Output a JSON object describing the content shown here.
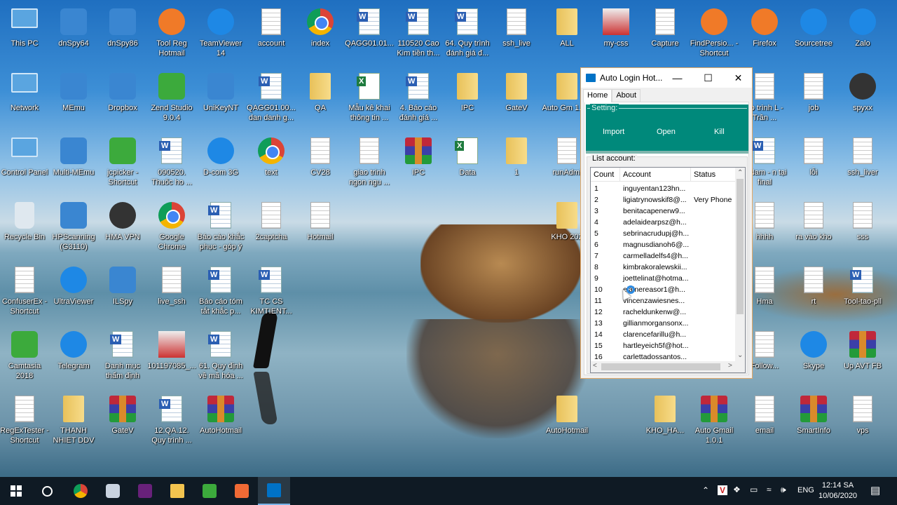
{
  "desktop": {
    "columns": [
      [
        {
          "label": "This PC",
          "icon": "pc"
        },
        {
          "label": "Network",
          "icon": "pc"
        },
        {
          "label": "Control Panel",
          "icon": "pc"
        },
        {
          "label": "Recycle Bin",
          "icon": "bin"
        },
        {
          "label": "ConfuserEx - Shortcut",
          "icon": "doc"
        },
        {
          "label": "Camtasia 2018",
          "icon": "green"
        },
        {
          "label": "RegExTester - Shortcut",
          "icon": "doc"
        }
      ],
      [
        {
          "label": "dnSpy64",
          "icon": "app"
        },
        {
          "label": "MEmu",
          "icon": "app"
        },
        {
          "label": "Multi-MEmu",
          "icon": "app"
        },
        {
          "label": "HPScanning (G3110)",
          "icon": "app"
        },
        {
          "label": "UltraViewer",
          "icon": "round"
        },
        {
          "label": "Telegram",
          "icon": "round"
        },
        {
          "label": "THANH NHIET DDV",
          "icon": "folder"
        }
      ],
      [
        {
          "label": "dnSpy86",
          "icon": "app"
        },
        {
          "label": "Dropbox",
          "icon": "app"
        },
        {
          "label": "jcpicker - Shortcut",
          "icon": "green"
        },
        {
          "label": "HMA VPN",
          "icon": "dark"
        },
        {
          "label": "ILSpy",
          "icon": "app"
        },
        {
          "label": "Danh mục thẩm định",
          "icon": "word"
        },
        {
          "label": "GateV",
          "icon": "winrar"
        }
      ],
      [
        {
          "label": "Tool Reg Hotmail",
          "icon": "orange"
        },
        {
          "label": "Zend Studio 9.0.4",
          "icon": "green"
        },
        {
          "label": "090520. Thuốc ho ...",
          "icon": "word"
        },
        {
          "label": "Google Chrome",
          "icon": "chrome"
        },
        {
          "label": "live_ssh",
          "icon": "doc"
        },
        {
          "label": "101197085_...",
          "icon": "pic"
        },
        {
          "label": "12.QA.12. Quy trình ...",
          "icon": "word"
        }
      ],
      [
        {
          "label": "TeamViewer 14",
          "icon": "round"
        },
        {
          "label": "UniKeyNT",
          "icon": "app"
        },
        {
          "label": "D-com 3G",
          "icon": "round"
        },
        {
          "label": "Báo cáo khắc phục - góp ý",
          "icon": "word"
        },
        {
          "label": "Báo cáo tóm tắt khắc p...",
          "icon": "word"
        },
        {
          "label": "61. Quy định về mã hóa ...",
          "icon": "word"
        },
        {
          "label": "AutoHotmail",
          "icon": "winrar"
        }
      ],
      [
        {
          "label": "account",
          "icon": "doc"
        },
        {
          "label": "QAGG01.00... dan danh g...",
          "icon": "word"
        },
        {
          "label": "text",
          "icon": "chrome"
        },
        {
          "label": "2captcha",
          "icon": "doc"
        },
        {
          "label": "TC CS KIMTIENT...",
          "icon": "word"
        },
        null,
        null
      ],
      [
        {
          "label": "index",
          "icon": "chrome"
        },
        {
          "label": "QA",
          "icon": "folder"
        },
        {
          "label": "CV28",
          "icon": "doc"
        },
        {
          "label": "Hotmail",
          "icon": "doc"
        },
        null,
        null,
        null
      ],
      [
        {
          "label": "QAGG01.01...",
          "icon": "word"
        },
        {
          "label": "Mẫu kê khai thông tin ...",
          "icon": "excel"
        },
        {
          "label": "giao trinh ngon ngu ...",
          "icon": "doc"
        },
        null,
        null,
        null,
        null
      ],
      [
        {
          "label": "110520 Cao Kim tiền th...",
          "icon": "word"
        },
        {
          "label": "4. Báo cáo đánh giá ...",
          "icon": "word"
        },
        {
          "label": "IPC",
          "icon": "winrar"
        },
        null,
        null,
        null,
        null
      ],
      [
        {
          "label": "64. Quy trình đánh giá đ...",
          "icon": "word"
        },
        {
          "label": "IPC",
          "icon": "folder"
        },
        {
          "label": "Data",
          "icon": "excel"
        },
        null,
        null,
        null,
        null
      ],
      [
        {
          "label": "ssh_live",
          "icon": "doc"
        },
        {
          "label": "GateV",
          "icon": "folder"
        },
        {
          "label": "1",
          "icon": "folder"
        },
        null,
        null,
        null,
        null
      ],
      [
        {
          "label": "ALL",
          "icon": "folder"
        },
        {
          "label": "Auto Gm 1.0.1",
          "icon": "folder"
        },
        {
          "label": "runAdmi",
          "icon": "doc"
        },
        {
          "label": "KHO 202",
          "icon": "folder"
        },
        null,
        null,
        {
          "label": "AutoHotmail",
          "icon": "folder"
        }
      ],
      [
        {
          "label": "my-css",
          "icon": "pic"
        },
        null,
        null,
        null,
        null,
        null,
        null
      ],
      [
        {
          "label": "Capture",
          "icon": "doc"
        },
        null,
        null,
        null,
        null,
        null,
        {
          "label": "KHO_HA...",
          "icon": "folder"
        }
      ],
      [
        {
          "label": "FindPersio... - Shortcut",
          "icon": "orange"
        },
        null,
        null,
        null,
        null,
        null,
        {
          "label": "Auto Gmail 1.0.1",
          "icon": "winrar"
        }
      ],
      [
        {
          "label": "Firefox",
          "icon": "orange"
        },
        {
          "label": "áo trình L - Trần ...",
          "icon": "doc"
        },
        {
          "label": "à Nam - n tại final",
          "icon": "word"
        },
        {
          "label": "hhhh",
          "icon": "doc"
        },
        {
          "label": "Hma",
          "icon": "doc"
        },
        {
          "label": "Follow...",
          "icon": "doc"
        },
        {
          "label": "email",
          "icon": "doc"
        }
      ],
      [
        {
          "label": "Sourcetree",
          "icon": "round"
        },
        {
          "label": "job",
          "icon": "doc"
        },
        {
          "label": "lỗi",
          "icon": "doc"
        },
        {
          "label": "ra vào kho",
          "icon": "doc"
        },
        {
          "label": "rt",
          "icon": "doc"
        },
        {
          "label": "Skype",
          "icon": "round"
        },
        {
          "label": "SmartInfo",
          "icon": "winrar"
        }
      ],
      [
        {
          "label": "Zalo",
          "icon": "round"
        },
        {
          "label": "spyxx",
          "icon": "dark"
        },
        {
          "label": "ssh_liver",
          "icon": "doc"
        },
        {
          "label": "sss",
          "icon": "doc"
        },
        {
          "label": "Tool-tao-pll",
          "icon": "word"
        },
        {
          "label": "Up AVT FB",
          "icon": "winrar"
        },
        {
          "label": "vps",
          "icon": "doc"
        }
      ]
    ]
  },
  "window": {
    "title": "Auto Login Hot...",
    "tabs": [
      "Home",
      "About"
    ],
    "active_tab": "Home",
    "setting": {
      "legend": "Setting:",
      "import": "Import",
      "open": "Open",
      "kill": "Kill",
      "color": "#00897b"
    },
    "list": {
      "legend": "List account:",
      "headers": [
        "Count",
        "Account",
        "Status"
      ],
      "rows": [
        [
          "1",
          "inguyentan123hn...",
          ""
        ],
        [
          "2",
          "ligiatrynowskif8@...",
          "Very Phone"
        ],
        [
          "3",
          "benitacapenerw9...",
          ""
        ],
        [
          "4",
          "adelaidearpsz@h...",
          ""
        ],
        [
          "5",
          "sebrinacrudupj@h...",
          ""
        ],
        [
          "6",
          "magnusdianoh6@...",
          ""
        ],
        [
          "7",
          "carmelladelfs4@h...",
          ""
        ],
        [
          "8",
          "kimbrakoralewskii...",
          ""
        ],
        [
          "9",
          "joettelinat@hotma...",
          ""
        ],
        [
          "10",
          "elainereasor1@h...",
          ""
        ],
        [
          "11",
          "vincenzawiesnes...",
          ""
        ],
        [
          "12",
          "racheldunkenw@...",
          ""
        ],
        [
          "13",
          "gillianmorgansonx...",
          ""
        ],
        [
          "14",
          "clarencefarillu@h...",
          ""
        ],
        [
          "15",
          "hartleyeich5f@hot...",
          ""
        ],
        [
          "16",
          "carlettadossantos...",
          ""
        ]
      ]
    }
  },
  "taskbar": {
    "items": [
      "start",
      "search",
      "chrome",
      "app",
      "visual-studio",
      "file-explorer",
      "camtasia",
      "orange-app",
      "outlook"
    ],
    "active": "outlook",
    "tray": {
      "language": "ENG",
      "time": "12:14 SA",
      "date": "10/06/2020"
    }
  }
}
